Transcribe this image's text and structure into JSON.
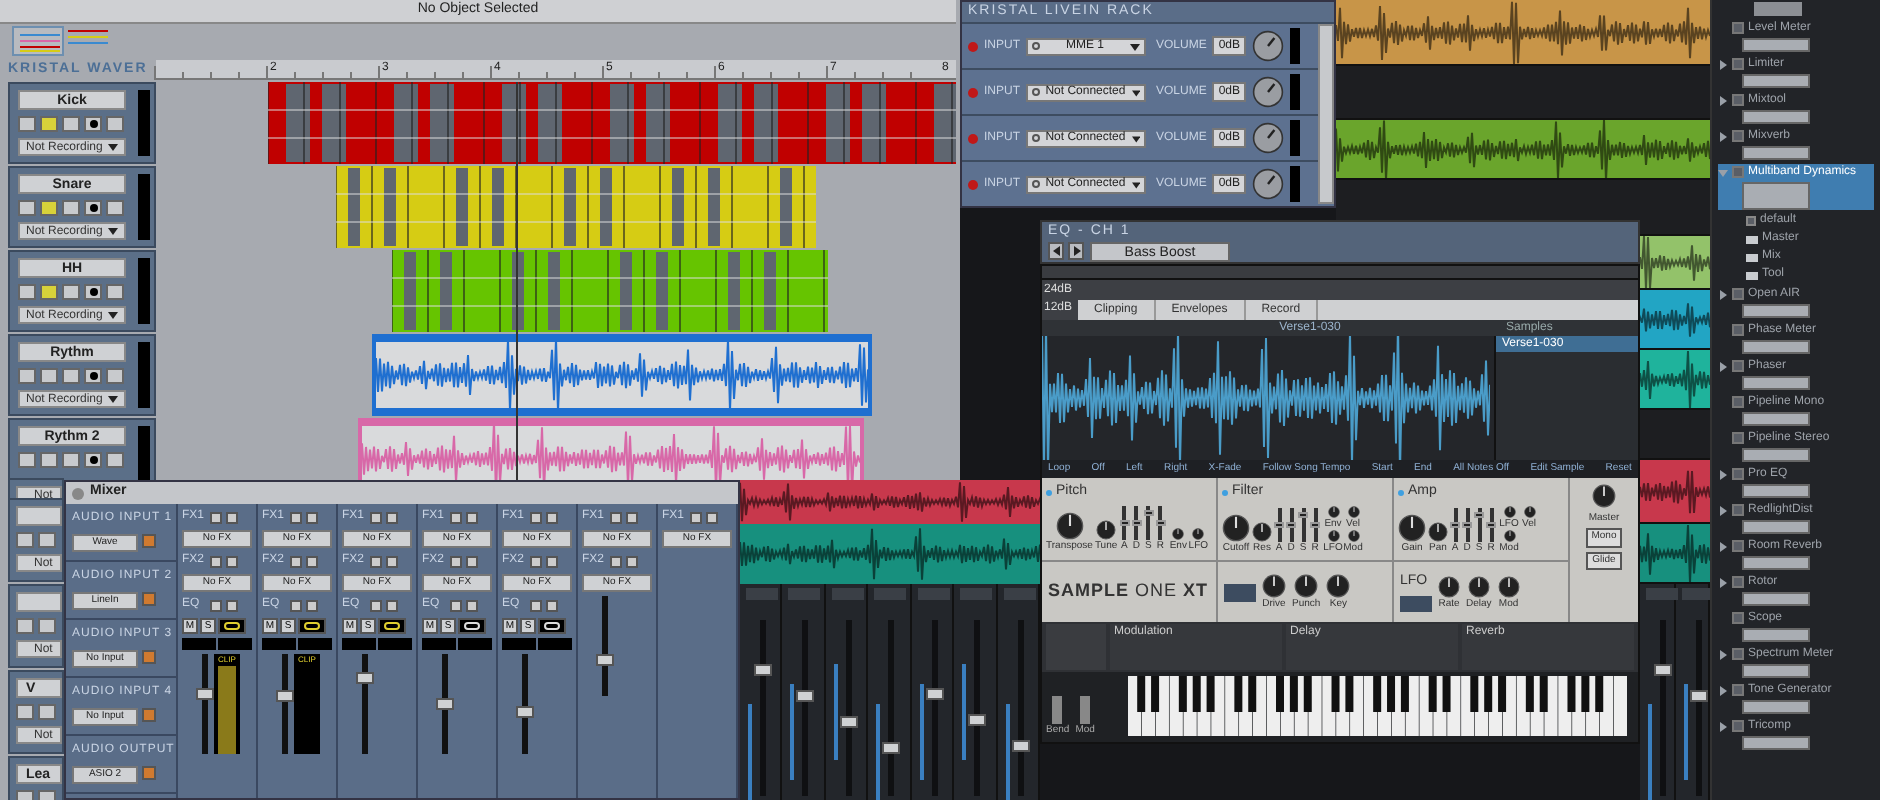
{
  "arranger": {
    "status": "No Object Selected",
    "logo": "KRISTAL WAVER",
    "ruler": [
      "2",
      "3",
      "4",
      "5",
      "6",
      "7",
      "8"
    ],
    "tracks": [
      {
        "name": "Kick",
        "recording": "Not Recording",
        "loop": true,
        "kind": "pattern",
        "color": "#c00000"
      },
      {
        "name": "Snare",
        "recording": "Not Recording",
        "loop": true,
        "kind": "pattern",
        "color": "#d6cc14"
      },
      {
        "name": "HH",
        "recording": "Not Recording",
        "loop": true,
        "kind": "pattern",
        "color": "#66c400"
      },
      {
        "name": "Rythm",
        "recording": "Not Recording",
        "loop": false,
        "kind": "audio",
        "color": "#1f6fd0"
      },
      {
        "name": "Rythm 2",
        "loop": false,
        "kind": "audio",
        "color": "#d868a8"
      }
    ],
    "covered_tracks": [
      {
        "recording": "Not"
      },
      {
        "recording": "Not"
      },
      {
        "recording": "Not"
      },
      {
        "name": "V",
        "recording": "Not"
      },
      {
        "name": "Lea"
      }
    ]
  },
  "rack": {
    "title": "KRISTAL LIVEIN RACK",
    "rows": [
      {
        "input_label": "INPUT",
        "source": "MME 1",
        "volume_label": "VOLUME",
        "volume": "0dB"
      },
      {
        "input_label": "INPUT",
        "source": "Not Connected",
        "volume_label": "VOLUME",
        "volume": "0dB"
      },
      {
        "input_label": "INPUT",
        "source": "Not Connected",
        "volume_label": "VOLUME",
        "volume": "0dB"
      },
      {
        "input_label": "INPUT",
        "source": "Not Connected",
        "volume_label": "VOLUME",
        "volume": "0dB"
      }
    ]
  },
  "lanes": [
    {
      "kind": "clip",
      "color": "#c89548"
    },
    {
      "kind": "empty"
    },
    {
      "kind": "clip",
      "color": "#6aa52c"
    },
    {
      "kind": "empty"
    },
    {
      "kind": "clip",
      "color": "#93c26a"
    },
    {
      "kind": "clip",
      "color": "#22a5c4"
    },
    {
      "kind": "clip",
      "color": "#1fb39c"
    },
    {
      "kind": "empty"
    },
    {
      "kind": "clip",
      "color": "#c8384c"
    },
    {
      "kind": "clip",
      "color": "#17907e"
    }
  ],
  "eq": {
    "title": "EQ - CH 1",
    "preset": "Bass Boost",
    "scale": [
      "24dB",
      "12dB"
    ]
  },
  "sampler": {
    "subtabs": [
      "Clipping",
      "Envelopes",
      "Record"
    ],
    "wave_title": "Verse1-030",
    "samples_label": "Samples",
    "samples": [
      {
        "name": "Verse1-030",
        "selected": true
      }
    ],
    "params": [
      "Loop",
      "Off",
      "Left",
      "Right",
      "X-Fade",
      "Follow Song Tempo",
      "Start",
      "End",
      "All Notes Off",
      "Edit Sample",
      "Reset"
    ],
    "sections": [
      {
        "title": "Pitch",
        "big": [
          "Transpose",
          "Tune"
        ],
        "sliders": [
          {
            "label": "A",
            "level": 0.5
          },
          {
            "label": "D",
            "level": 0.5
          },
          {
            "label": "S",
            "level": 0.8
          },
          {
            "label": "R",
            "level": 0.5
          }
        ],
        "small": [
          "Env",
          "LFO"
        ]
      },
      {
        "title": "Filter",
        "big": [
          "Cutoff",
          "Res"
        ],
        "sliders": [
          {
            "label": "A",
            "level": 0.5
          },
          {
            "label": "D",
            "level": 0.5
          },
          {
            "label": "S",
            "level": 0.8
          },
          {
            "label": "R",
            "level": 0.5
          }
        ],
        "small": [
          "Env",
          "Vel",
          "LFO",
          "Mod"
        ]
      },
      {
        "title": "Amp",
        "big": [
          "Gain",
          "Pan"
        ],
        "sliders": [
          {
            "label": "A",
            "level": 0.5
          },
          {
            "label": "D",
            "level": 0.5
          },
          {
            "label": "S",
            "level": 0.8
          },
          {
            "label": "R",
            "level": 0.5
          }
        ],
        "small": [
          "LFO",
          "Vel",
          "Mod"
        ]
      }
    ],
    "logo": "**SAMPLE** ONE **XT**",
    "filter_knobs": [
      "Drive",
      "Punch",
      "Key"
    ],
    "lfo": {
      "title": "LFO",
      "knobs": [
        "Rate",
        "Delay",
        "Mod"
      ]
    },
    "master": {
      "knob": "Master",
      "buttons": [
        "Mono",
        "Glide"
      ]
    },
    "effects": [
      "Modulation",
      "Delay",
      "Reverb"
    ],
    "wheels": [
      "Bend",
      "Mod"
    ]
  },
  "mixer": {
    "title": "Mixer",
    "inputs": [
      {
        "label": "AUDIO INPUT 1",
        "source": "Wave"
      },
      {
        "label": "AUDIO INPUT 2",
        "source": "LineIn"
      },
      {
        "label": "AUDIO INPUT 3",
        "source": "No Input"
      },
      {
        "label": "AUDIO INPUT 4",
        "source": "No Input"
      },
      {
        "label": "AUDIO OUTPUT",
        "source": "ASIO 2"
      }
    ],
    "channels": [
      {
        "fx1_label": "FX1",
        "fx1": "No FX",
        "fx2_label": "FX2",
        "fx2": "No FX",
        "eq_label": "EQ",
        "mute": "M",
        "solo": "S",
        "linked": true,
        "clip": "CLIP",
        "level": 0.62
      },
      {
        "fx1_label": "FX1",
        "fx1": "No FX",
        "fx2_label": "FX2",
        "fx2": "No FX",
        "eq_label": "EQ",
        "mute": "M",
        "solo": "S",
        "linked": true,
        "clip": "CLIP",
        "level": 0.58
      },
      {
        "fx1_label": "FX1",
        "fx1": "No FX",
        "fx2_label": "FX2",
        "fx2": "No FX",
        "eq_label": "EQ",
        "mute": "M",
        "solo": "S",
        "linked": true,
        "level": 0.8
      },
      {
        "fx1_label": "FX1",
        "fx1": "No FX",
        "fx2_label": "FX2",
        "fx2": "No FX",
        "eq_label": "EQ",
        "mute": "M",
        "solo": "S",
        "linked": false,
        "level": 0.5
      },
      {
        "fx1_label": "FX1",
        "fx1": "No FX",
        "fx2_label": "FX2",
        "fx2": "No FX",
        "eq_label": "EQ",
        "mute": "M",
        "solo": "S",
        "linked": false,
        "level": 0.4
      },
      {
        "fx1_label": "FX1",
        "fx1": "No FX",
        "fx2_label": "FX2",
        "fx2": "No FX",
        "level": 0.35
      },
      {
        "fx1_label": "FX1",
        "fx1": "No FX"
      }
    ]
  },
  "browser": {
    "items": [
      {
        "name": "Level Meter",
        "selected": false
      },
      {
        "name": "Limiter",
        "selected": false,
        "expanded": false
      },
      {
        "name": "Mixtool",
        "selected": false,
        "expanded": false
      },
      {
        "name": "Mixverb",
        "selected": false,
        "expanded": false
      },
      {
        "name": "Multiband Dynamics",
        "selected": true,
        "expanded": true,
        "children": [
          {
            "name": "default",
            "kind": "preset"
          },
          {
            "name": "Master",
            "kind": "folder"
          },
          {
            "name": "Mix",
            "kind": "folder"
          },
          {
            "name": "Tool",
            "kind": "folder"
          }
        ]
      },
      {
        "name": "Open AIR",
        "selected": false,
        "expanded": false
      },
      {
        "name": "Phase Meter",
        "selected": false
      },
      {
        "name": "Phaser",
        "selected": false,
        "expanded": false
      },
      {
        "name": "Pipeline Mono",
        "selected": false
      },
      {
        "name": "Pipeline Stereo",
        "selected": false
      },
      {
        "name": "Pro EQ",
        "selected": false,
        "expanded": false
      },
      {
        "name": "RedlightDist",
        "selected": false,
        "expanded": false
      },
      {
        "name": "Room Reverb",
        "selected": false,
        "expanded": false
      },
      {
        "name": "Rotor",
        "selected": false,
        "expanded": false
      },
      {
        "name": "Scope",
        "selected": false
      },
      {
        "name": "Spectrum Meter",
        "selected": false,
        "expanded": false
      },
      {
        "name": "Tone Generator",
        "selected": false,
        "expanded": false
      },
      {
        "name": "Tricomp",
        "selected": false,
        "expanded": false
      }
    ]
  }
}
